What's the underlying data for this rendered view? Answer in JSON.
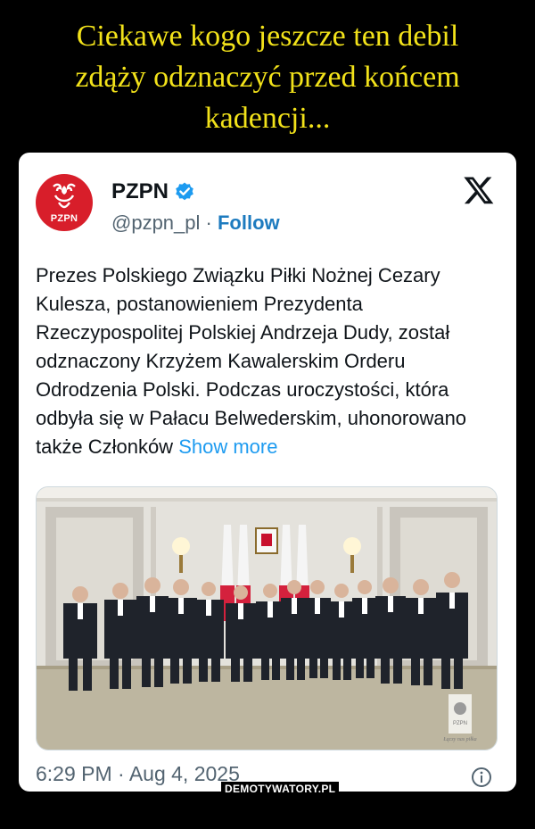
{
  "meme": {
    "title_line1": "Ciekawe kogo jeszcze ten debil",
    "title_line2": "zdąży odznaczyć przed końcem",
    "title_line3": "kadencji..."
  },
  "tweet": {
    "avatar_text": "PZPN",
    "author_name": "PZPN",
    "handle": "@pzpn_pl",
    "separator": " · ",
    "follow_label": "Follow",
    "text": "Prezes Polskiego Związku Piłki Nożnej Cezary Kulesza, postanowieniem Prezydenta Rzeczypospolitej Polskiej Andrzeja Dudy, został odznaczony Krzyżem Kawalerskim Orderu Odrodzenia Polski. Podczas uroczystości, która odbyła się w Pałacu Belwederskim, uhonorowano także Członków",
    "show_more_label": "Show more",
    "timestamp": "6:29 PM · Aug 4, 2025",
    "photo_logo_text": "PZPN",
    "photo_logo_tagline": "Łączy nas piłka"
  },
  "icons": {
    "verified": "verified-badge-icon",
    "platform": "x-logo-icon",
    "info": "info-icon"
  },
  "colors": {
    "title_yellow": "#f2e21a",
    "pzpn_red": "#d81e2a",
    "link_blue": "#1d9bf0",
    "verified_blue": "#1d9bf0"
  },
  "watermark": "DEMOTYWATORY.PL"
}
